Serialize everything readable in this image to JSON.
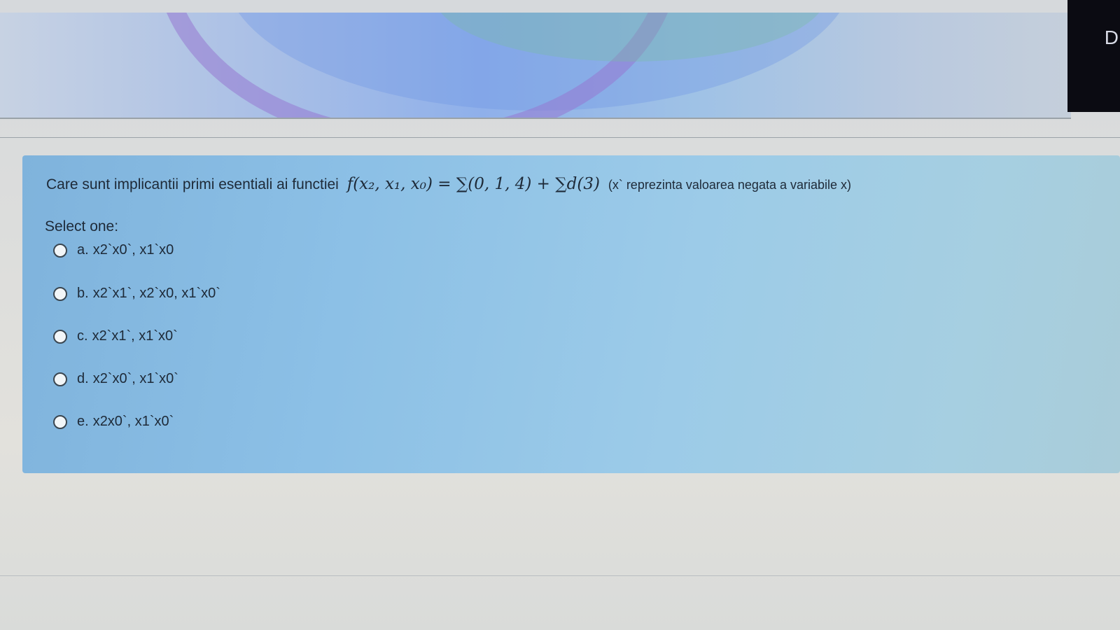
{
  "corner": {
    "label": "D"
  },
  "question": {
    "text": "Care sunt implicantii primi esentiali ai functiei",
    "formula": "f(x₂, x₁, x₀) = ∑(0, 1, 4) + ∑d(3)",
    "note": "(x` reprezinta valoarea negata a variabile x)"
  },
  "select_label": "Select one:",
  "options": [
    {
      "letter": "a.",
      "text": "x2`x0`, x1`x0"
    },
    {
      "letter": "b.",
      "text": "x2`x1`, x2`x0, x1`x0`"
    },
    {
      "letter": "c.",
      "text": "x2`x1`, x1`x0`"
    },
    {
      "letter": "d.",
      "text": "x2`x0`, x1`x0`"
    },
    {
      "letter": "e.",
      "text": "x2x0`, x1`x0`"
    }
  ]
}
